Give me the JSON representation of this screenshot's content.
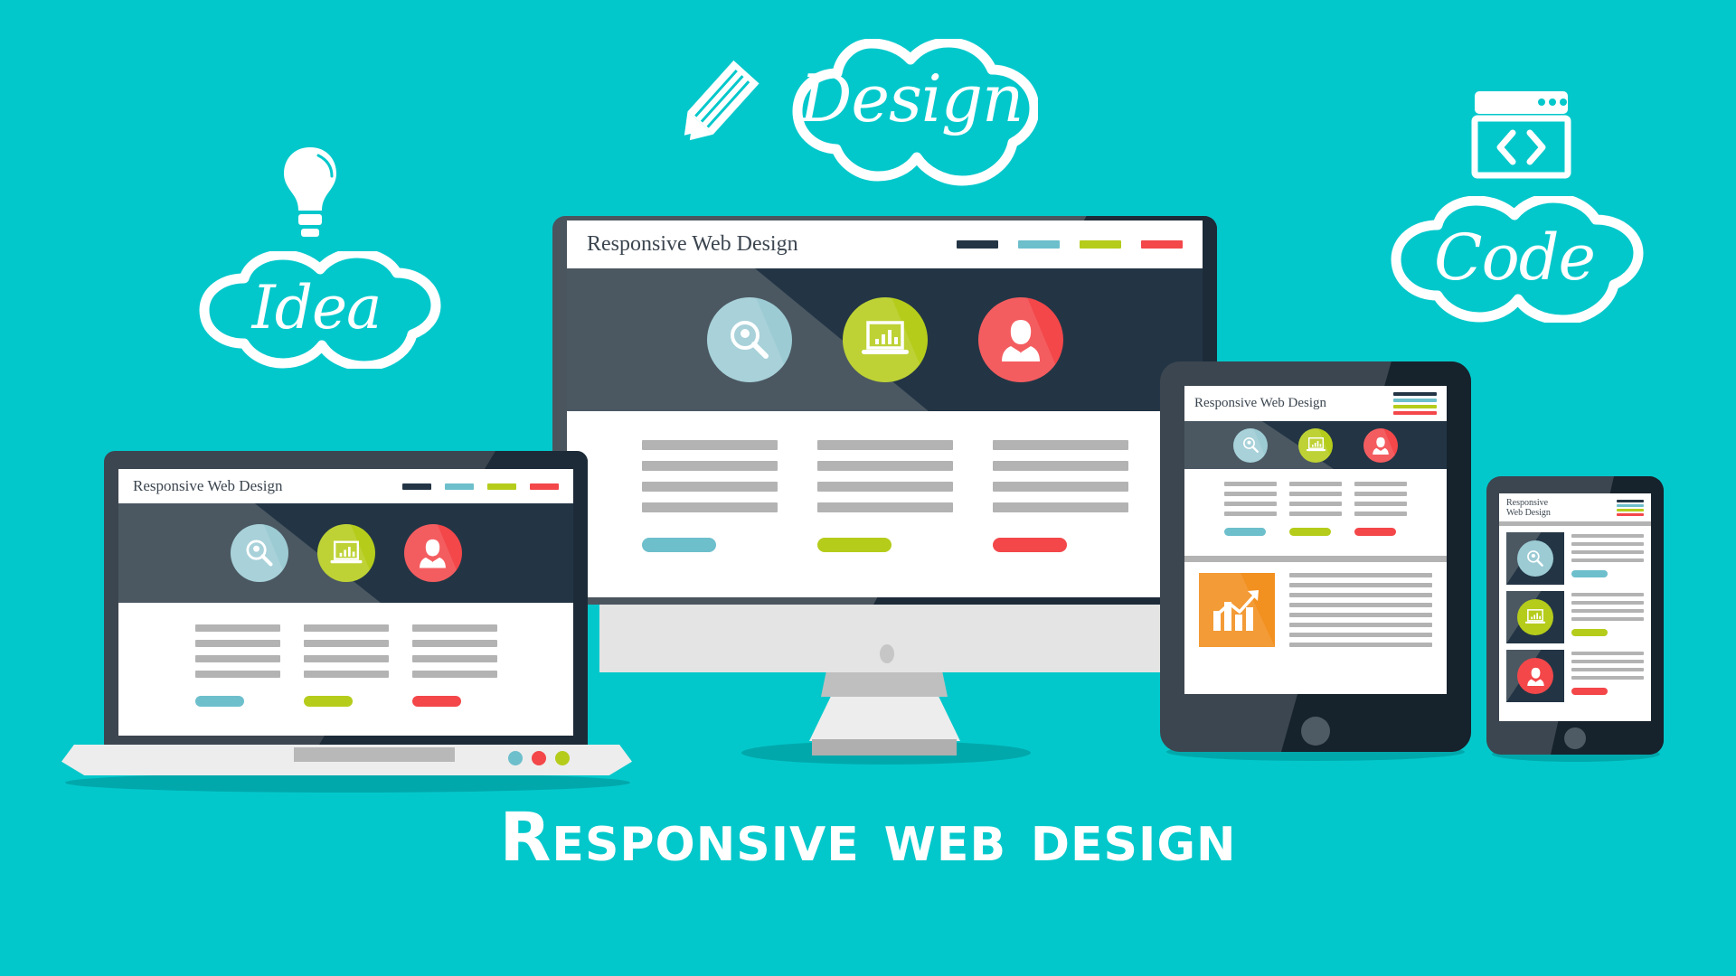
{
  "background_color": "#03C8CB",
  "page_title": "Responsive web design",
  "palette": {
    "background": "#03C8CB",
    "navy": "#233545",
    "frame_gray": "#4A555E",
    "teal_accent": "#6DBFCC",
    "lime_accent": "#B5CC1B",
    "red_accent": "#F3474A",
    "orange": "#F29020",
    "text_gray": "#B3B3B3",
    "white": "#FFFFFF"
  },
  "doodles": [
    {
      "id": "idea",
      "label": "Idea",
      "icon": "lightbulb-icon"
    },
    {
      "id": "design",
      "label": "Design",
      "icon": "pencil-icon"
    },
    {
      "id": "code",
      "label": "Code",
      "icon": "browser-code-icon"
    }
  ],
  "site": {
    "title": "Responsive Web Design",
    "title_line1": "Responsive",
    "title_line2": "Web Design",
    "nav_colors": [
      "#233545",
      "#6DBFCC",
      "#B5CC1B",
      "#F3474A"
    ],
    "features": [
      {
        "icon": "search-icon",
        "color": "#9CCBD4",
        "button_color": "#6DBFCC",
        "text_lines": 4
      },
      {
        "icon": "chart-laptop-icon",
        "color": "#B5CC1B",
        "button_color": "#B5CC1B",
        "text_lines": 4
      },
      {
        "icon": "user-icon",
        "color": "#F3474A",
        "button_color": "#F3474A",
        "text_lines": 4
      }
    ],
    "article": {
      "image_icon": "bar-chart-growth-icon",
      "image_color": "#F29020",
      "text_lines": 8
    }
  },
  "devices": [
    {
      "id": "monitor",
      "name": "Desktop monitor",
      "indicator_dots": []
    },
    {
      "id": "laptop",
      "name": "Laptop",
      "indicator_dots": [
        "#6DBFCC",
        "#F3474A",
        "#B5CC1B"
      ]
    },
    {
      "id": "tablet",
      "name": "Tablet",
      "indicator_dots": []
    },
    {
      "id": "phone",
      "name": "Smartphone",
      "indicator_dots": []
    }
  ]
}
